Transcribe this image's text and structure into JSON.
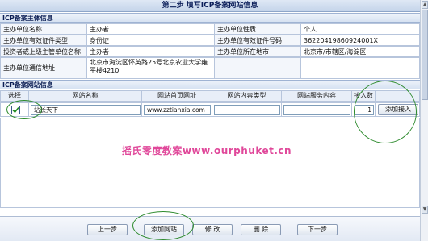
{
  "header": {
    "title": "第二步 填写ICP备案网站信息"
  },
  "sponsor_section": {
    "heading": "ICP备案主体信息",
    "rows": [
      {
        "l1": "主办单位名称",
        "v1": "主办者",
        "l2": "主办单位性质",
        "v2": "个人"
      },
      {
        "l1": "主办单位有效证件类型",
        "v1": "身份证",
        "l2": "主办单位有效证件号码",
        "v2": "362204198609240​01X"
      },
      {
        "l1": "投资者或上级主管单位名称",
        "v1": "主办者",
        "l2": "主办单位所在地市",
        "v2": "北京市/市辖区/海淀区"
      },
      {
        "l1": "主办单位通信地址",
        "v1": "北京市海淀区怀英路25号北京农业大学雍平楼4210",
        "l2": "",
        "v2": ""
      }
    ]
  },
  "website_section": {
    "heading": "ICP备案网站信息",
    "columns": [
      "选择",
      "网站名称",
      "网站首页网址",
      "网站内容类型",
      "网站服务内容",
      "接入数"
    ],
    "row": {
      "selected": true,
      "name": "站长天下",
      "url": "www.zztianxia.com",
      "content_type": "",
      "service_content": "",
      "access_count": "1",
      "add_access_label": "添加接入"
    }
  },
  "watermark": "摇氏零度教案www.ourphuket.cn",
  "toolbar": {
    "prev_label": "上一步",
    "add_site_label": "添加网站",
    "edit_label": "修 改",
    "delete_label": "删 除",
    "next_label": "下一步"
  },
  "colors": {
    "accent_dark": "#0a1d59",
    "annotation_green": "#2c8a2c",
    "watermark_pink": "#e0489a"
  }
}
